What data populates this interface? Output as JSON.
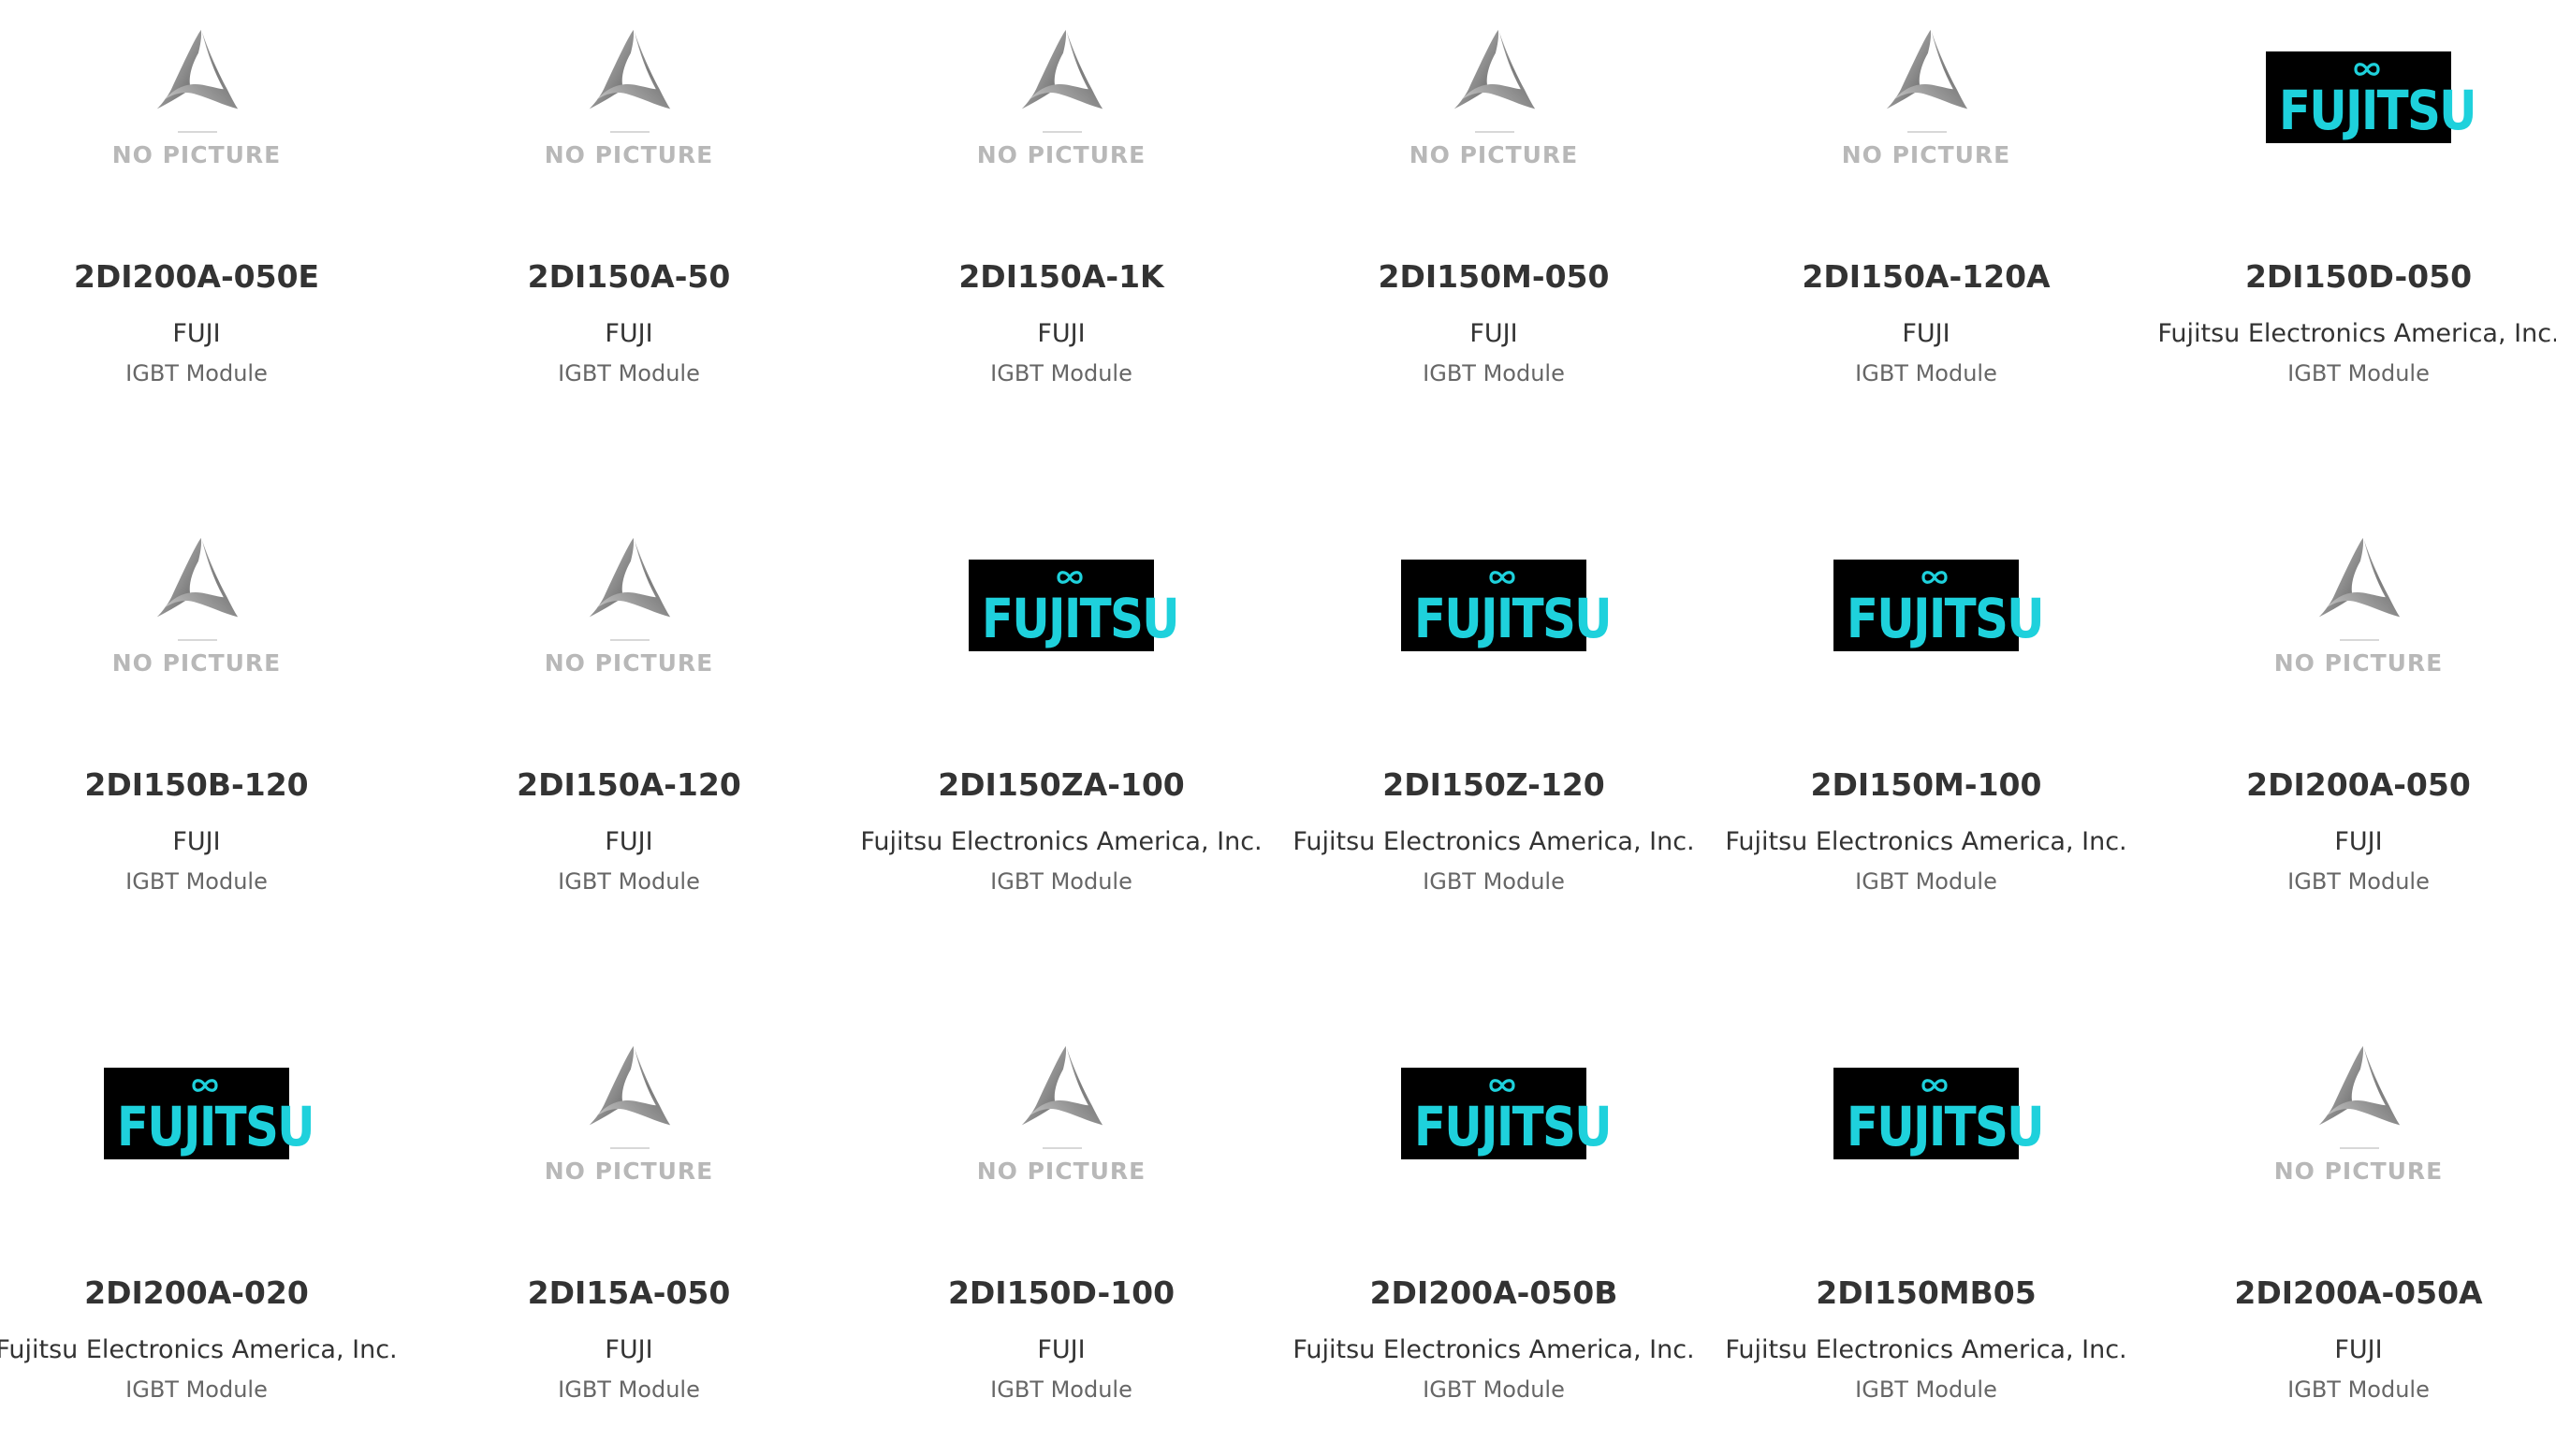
{
  "placeholder": {
    "label": "NO PICTURE"
  },
  "brand_logo": {
    "text": "FUJITSU",
    "background": "#000000",
    "text_color": "#1ed1dc"
  },
  "colors": {
    "part_text": "#333333",
    "manufacturer_text": "#333333",
    "category_text": "#666666",
    "placeholder_text": "#b8b8b8"
  },
  "products": [
    {
      "part": "2DI200A-050E",
      "manufacturer": "FUJI",
      "category": "IGBT Module",
      "image": "no-picture"
    },
    {
      "part": "2DI150A-50",
      "manufacturer": "FUJI",
      "category": "IGBT Module",
      "image": "no-picture"
    },
    {
      "part": "2DI150A-1K",
      "manufacturer": "FUJI",
      "category": "IGBT Module",
      "image": "no-picture"
    },
    {
      "part": "2DI150M-050",
      "manufacturer": "FUJI",
      "category": "IGBT Module",
      "image": "no-picture"
    },
    {
      "part": "2DI150A-120A",
      "manufacturer": "FUJI",
      "category": "IGBT Module",
      "image": "no-picture"
    },
    {
      "part": "2DI150D-050",
      "manufacturer": "Fujitsu Electronics America, Inc.",
      "category": "IGBT Module",
      "image": "fujitsu-logo"
    },
    {
      "part": "2DI150B-120",
      "manufacturer": "FUJI",
      "category": "IGBT Module",
      "image": "no-picture"
    },
    {
      "part": "2DI150A-120",
      "manufacturer": "FUJI",
      "category": "IGBT Module",
      "image": "no-picture"
    },
    {
      "part": "2DI150ZA-100",
      "manufacturer": "Fujitsu Electronics America, Inc.",
      "category": "IGBT Module",
      "image": "fujitsu-logo"
    },
    {
      "part": "2DI150Z-120",
      "manufacturer": "Fujitsu Electronics America, Inc.",
      "category": "IGBT Module",
      "image": "fujitsu-logo"
    },
    {
      "part": "2DI150M-100",
      "manufacturer": "Fujitsu Electronics America, Inc.",
      "category": "IGBT Module",
      "image": "fujitsu-logo"
    },
    {
      "part": "2DI200A-050",
      "manufacturer": "FUJI",
      "category": "IGBT Module",
      "image": "no-picture"
    },
    {
      "part": "2DI200A-020",
      "manufacturer": "Fujitsu Electronics America, Inc.",
      "category": "IGBT Module",
      "image": "fujitsu-logo"
    },
    {
      "part": "2DI15A-050",
      "manufacturer": "FUJI",
      "category": "IGBT Module",
      "image": "no-picture"
    },
    {
      "part": "2DI150D-100",
      "manufacturer": "FUJI",
      "category": "IGBT Module",
      "image": "no-picture"
    },
    {
      "part": "2DI200A-050B",
      "manufacturer": "Fujitsu Electronics America, Inc.",
      "category": "IGBT Module",
      "image": "fujitsu-logo"
    },
    {
      "part": "2DI150MB05",
      "manufacturer": "Fujitsu Electronics America, Inc.",
      "category": "IGBT Module",
      "image": "fujitsu-logo"
    },
    {
      "part": "2DI200A-050A",
      "manufacturer": "FUJI",
      "category": "IGBT Module",
      "image": "no-picture"
    }
  ]
}
